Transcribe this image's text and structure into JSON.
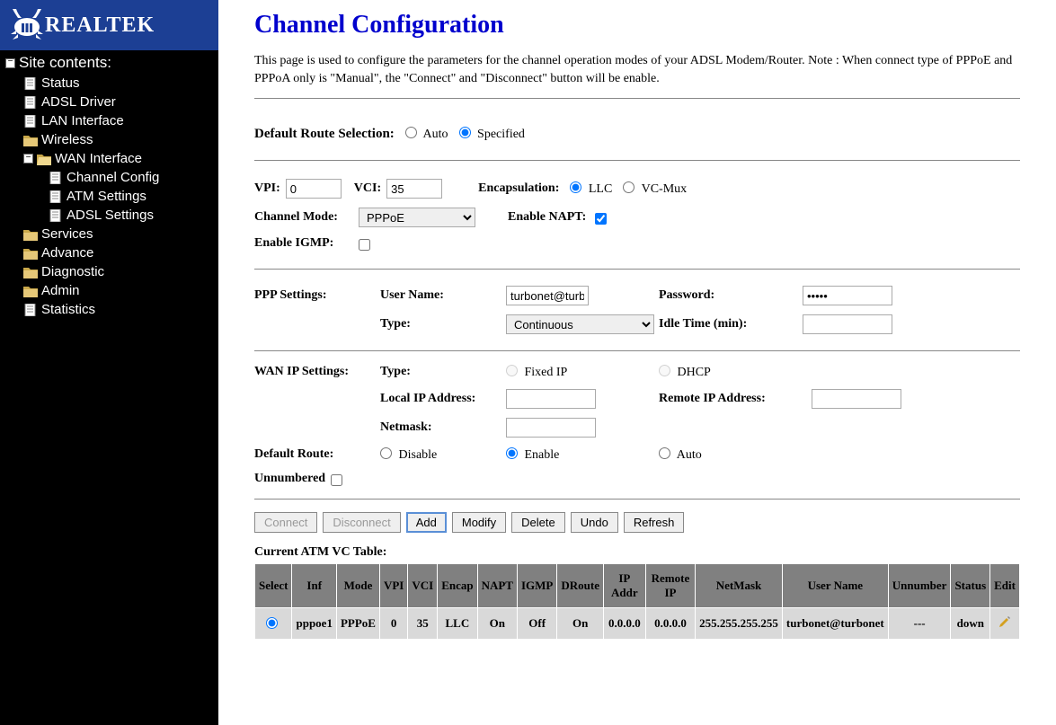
{
  "brand": "REALTEK",
  "sidebar": {
    "title": "Site contents:",
    "items": [
      {
        "label": "Status",
        "icon": "page",
        "level": 1
      },
      {
        "label": "ADSL Driver",
        "icon": "page",
        "level": 1
      },
      {
        "label": "LAN Interface",
        "icon": "page",
        "level": 1
      },
      {
        "label": "Wireless",
        "icon": "folder",
        "level": 1
      },
      {
        "label": "WAN Interface",
        "icon": "folder-open",
        "level": 1,
        "expand": "minus"
      },
      {
        "label": "Channel Config",
        "icon": "page",
        "level": 2
      },
      {
        "label": "ATM Settings",
        "icon": "page",
        "level": 2
      },
      {
        "label": "ADSL Settings",
        "icon": "page",
        "level": 2
      },
      {
        "label": "Services",
        "icon": "folder",
        "level": 1
      },
      {
        "label": "Advance",
        "icon": "folder",
        "level": 1
      },
      {
        "label": "Diagnostic",
        "icon": "folder",
        "level": 1
      },
      {
        "label": "Admin",
        "icon": "folder",
        "level": 1
      },
      {
        "label": "Statistics",
        "icon": "page",
        "level": 1
      }
    ]
  },
  "page": {
    "title": "Channel Configuration",
    "intro": "This page is used to configure the parameters for the channel operation modes of your ADSL Modem/Router. Note : When connect type of PPPoE and PPPoA only is \"Manual\", the \"Connect\" and \"Disconnect\" button will be enable.",
    "default_route_label": "Default Route Selection:",
    "default_route_options": {
      "auto": "Auto",
      "specified": "Specified"
    },
    "default_route_selected": "specified",
    "vpi_label": "VPI:",
    "vpi_value": "0",
    "vci_label": "VCI:",
    "vci_value": "35",
    "encap_label": "Encapsulation:",
    "encap_options": {
      "llc": "LLC",
      "vcmux": "VC-Mux"
    },
    "encap_selected": "llc",
    "channel_mode_label": "Channel Mode:",
    "channel_mode_value": "PPPoE",
    "napt_label": "Enable NAPT:",
    "napt_checked": true,
    "igmp_label": "Enable IGMP:",
    "igmp_checked": false,
    "ppp_section": "PPP Settings:",
    "ppp_user_label": "User Name:",
    "ppp_user_value": "turbonet@turbo",
    "ppp_pass_label": "Password:",
    "ppp_pass_value": "•••••",
    "ppp_type_label": "Type:",
    "ppp_type_value": "Continuous",
    "ppp_idle_label": "Idle Time (min):",
    "ppp_idle_value": "",
    "wan_section": "WAN IP Settings:",
    "wan_type_label": "Type:",
    "wan_type_options": {
      "fixed": "Fixed IP",
      "dhcp": "DHCP"
    },
    "wan_local_label": "Local IP Address:",
    "wan_remote_label": "Remote IP Address:",
    "wan_netmask_label": "Netmask:",
    "dr_label": "Default Route:",
    "dr_options": {
      "disable": "Disable",
      "enable": "Enable",
      "auto": "Auto"
    },
    "dr_selected": "enable",
    "unnumbered_label": "Unnumbered",
    "buttons": {
      "connect": "Connect",
      "disconnect": "Disconnect",
      "add": "Add",
      "modify": "Modify",
      "delete": "Delete",
      "undo": "Undo",
      "refresh": "Refresh"
    },
    "table_title": "Current ATM VC Table:",
    "table_headers": [
      "Select",
      "Inf",
      "Mode",
      "VPI",
      "VCI",
      "Encap",
      "NAPT",
      "IGMP",
      "DRoute",
      "IP Addr",
      "Remote IP",
      "NetMask",
      "User Name",
      "Unnumber",
      "Status",
      "Edit"
    ],
    "table_row": {
      "inf": "pppoe1",
      "mode": "PPPoE",
      "vpi": "0",
      "vci": "35",
      "encap": "LLC",
      "napt": "On",
      "igmp": "Off",
      "droute": "On",
      "ip": "0.0.0.0",
      "remote": "0.0.0.0",
      "netmask": "255.255.255.255",
      "user": "turbonet@turbonet",
      "unnumber": "---",
      "status": "down"
    }
  }
}
